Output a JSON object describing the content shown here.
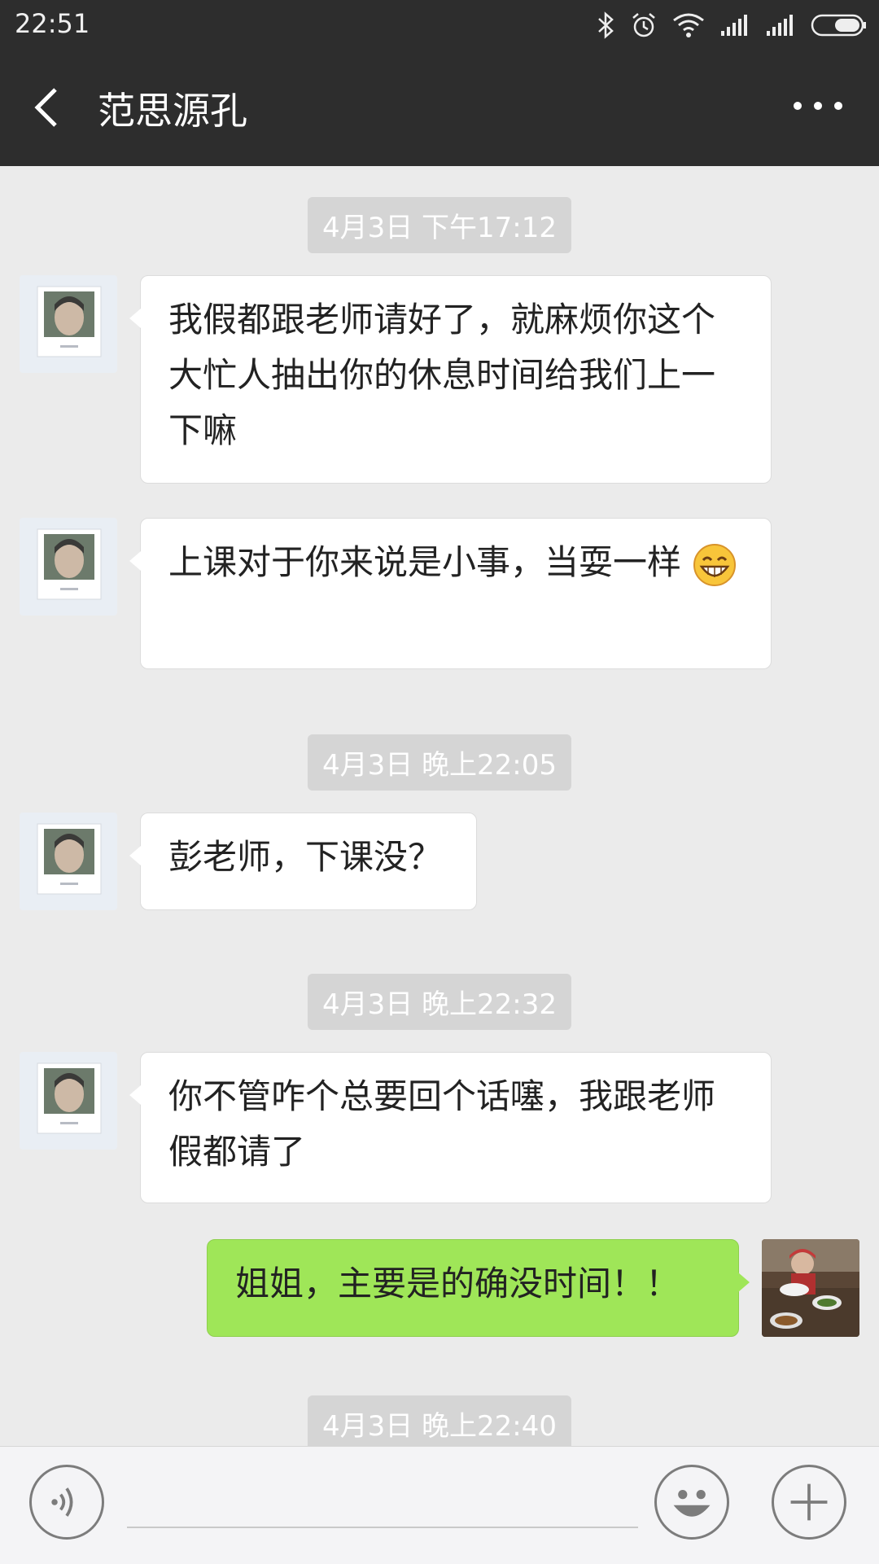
{
  "status": {
    "time": "22:51"
  },
  "header": {
    "title": "范思源孔"
  },
  "messages": [
    {
      "type": "timestamp",
      "text": "4月3日 下午17:12"
    },
    {
      "type": "left",
      "text": "我假都跟老师请好了，就麻烦你这个大忙人抽出你的休息时间给我们上一下嘛"
    },
    {
      "type": "left",
      "text": "上课对于你来说是小事，当耍一样",
      "emoji": "grin-emoji"
    },
    {
      "type": "timestamp",
      "text": "4月3日 晚上22:05"
    },
    {
      "type": "left",
      "text": "彭老师，下课没？"
    },
    {
      "type": "timestamp",
      "text": "4月3日 晚上22:32"
    },
    {
      "type": "left",
      "text": "你不管咋个总要回个话噻，我跟老师假都请了"
    },
    {
      "type": "right",
      "text": "姐姐，主要是的确没时间！！"
    },
    {
      "type": "timestamp",
      "text": "4月3日 晚上22:40"
    }
  ],
  "input": {
    "value": "",
    "placeholder": ""
  },
  "icons": {
    "back": "chevron-left-icon",
    "more": "more-dots-icon",
    "voice": "voice-icon",
    "emoji": "smiley-icon",
    "add": "plus-icon"
  },
  "colors": {
    "header_bg": "#2d2d2d",
    "chat_bg": "#ebebeb",
    "sent_bubble": "#9fe658",
    "received_bubble": "#ffffff",
    "timestamp_bg": "#d5d5d5"
  }
}
